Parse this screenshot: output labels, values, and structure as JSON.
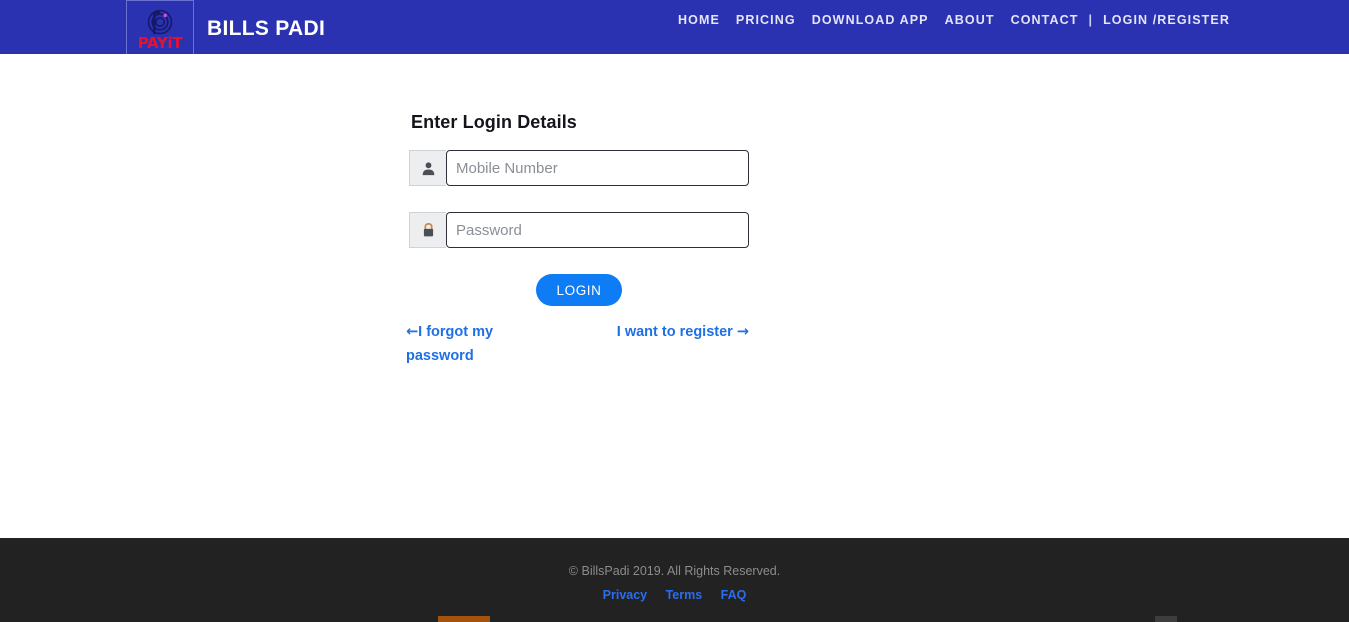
{
  "header": {
    "logo": {
      "icon": "payit-spiral-p-icon",
      "text": "PAYiT",
      "brand_color": "#e8112d"
    },
    "brand_name": "BILLS PADI",
    "background_color": "#2b32b2",
    "nav": [
      {
        "label": "HOME",
        "name": "nav-home"
      },
      {
        "label": "PRICING",
        "name": "nav-pricing"
      },
      {
        "label": "DOWNLOAD APP",
        "name": "nav-download-app"
      },
      {
        "label": "ABOUT",
        "name": "nav-about"
      },
      {
        "label": "CONTACT",
        "name": "nav-contact"
      },
      {
        "label": "|",
        "name": "nav-separator"
      },
      {
        "label": "LOGIN /REGISTER",
        "name": "nav-login-register"
      }
    ]
  },
  "login_form": {
    "title": "Enter Login Details",
    "mobile": {
      "placeholder": "Mobile Number",
      "value": "",
      "icon": "user-icon"
    },
    "password": {
      "placeholder": "Password",
      "value": "",
      "icon": "lock-icon"
    },
    "submit_label": "LOGIN",
    "submit_color": "#0d7cf5",
    "forgot_password_label": "I forgot my password",
    "forgot_password_arrow": "←",
    "register_label": "I want to register",
    "register_arrow": "→",
    "link_color": "#1f6fe5"
  },
  "footer": {
    "copyright": "© BillsPadi 2019. All Rights Reserved.",
    "links": [
      {
        "label": "Privacy",
        "name": "footer-link-privacy"
      },
      {
        "label": "Terms",
        "name": "footer-link-terms"
      },
      {
        "label": "FAQ",
        "name": "footer-link-faq"
      }
    ],
    "background_color": "#222222",
    "link_color": "#2a6df0"
  }
}
